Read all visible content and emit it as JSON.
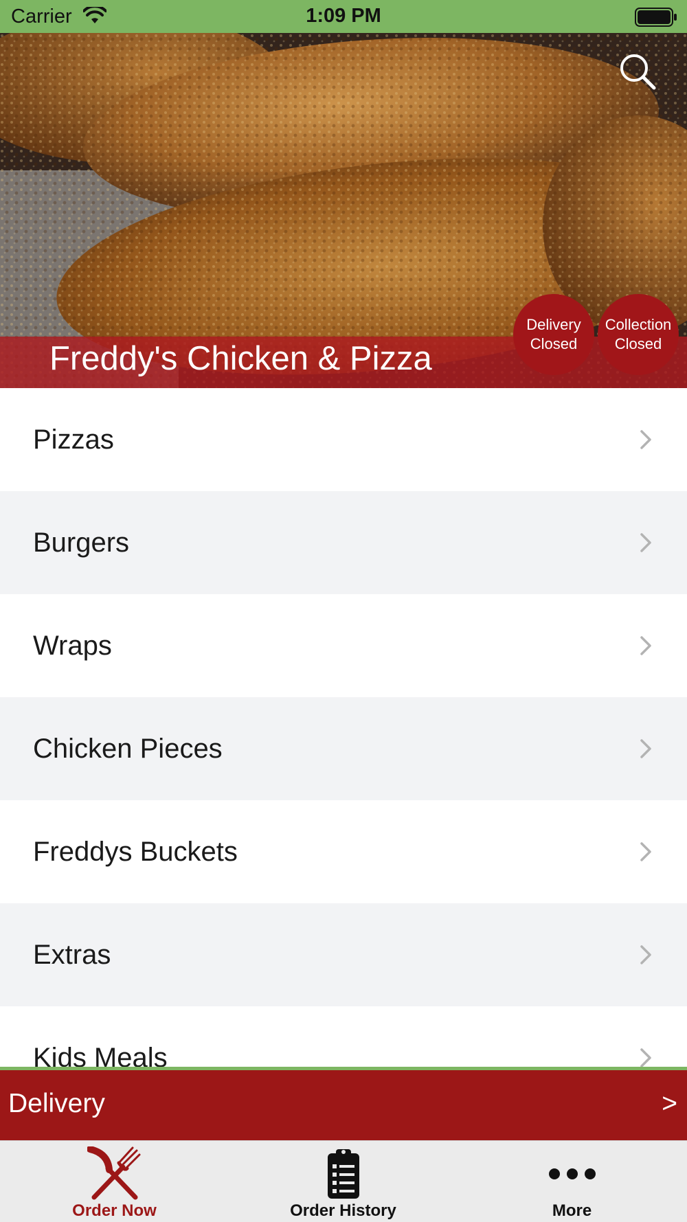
{
  "status_bar": {
    "carrier": "Carrier",
    "time": "1:09 PM",
    "background": "#7db662"
  },
  "hero": {
    "restaurant_name": "Freddy's Chicken & Pizza",
    "search_icon": "search-icon",
    "delivery_status": {
      "line1": "Delivery",
      "line2": "Closed"
    },
    "collection_status": {
      "line1": "Collection",
      "line2": "Closed"
    }
  },
  "menu": {
    "items": [
      {
        "label": "Pizzas"
      },
      {
        "label": "Burgers"
      },
      {
        "label": "Wraps"
      },
      {
        "label": "Chicken Pieces"
      },
      {
        "label": "Freddys Buckets"
      },
      {
        "label": "Extras"
      },
      {
        "label": "Kids Meals"
      }
    ],
    "chevron_icon": "chevron-right-icon"
  },
  "delivery_bar": {
    "label": "Delivery",
    "arrow": ">",
    "background": "#9c1717"
  },
  "tab_bar": {
    "tabs": [
      {
        "label": "Order Now",
        "icon": "fork-knife-icon",
        "active": true,
        "color": "#9c1717"
      },
      {
        "label": "Order History",
        "icon": "clipboard-icon",
        "active": false,
        "color": "#111111"
      },
      {
        "label": "More",
        "icon": "more-dots-icon",
        "active": false,
        "color": "#111111"
      }
    ]
  }
}
